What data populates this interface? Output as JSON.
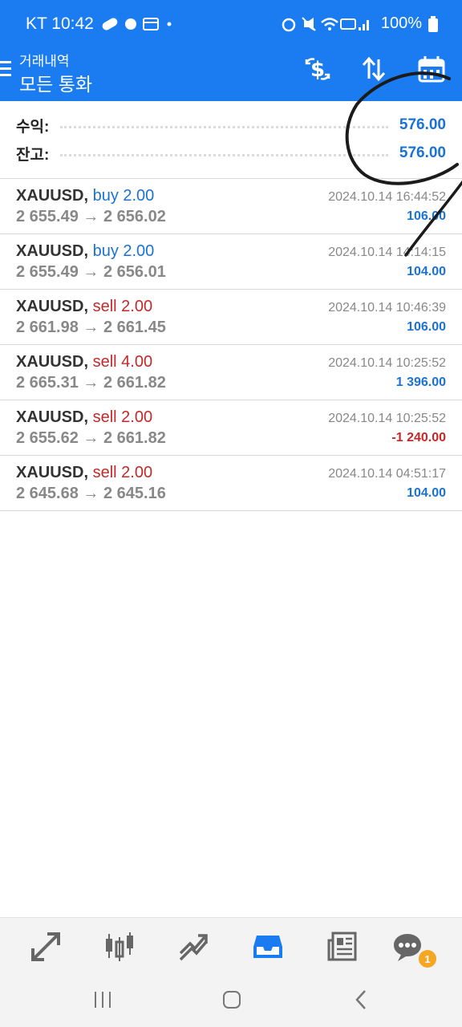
{
  "status_bar": {
    "carrier_time": "KT 10:42",
    "battery": "100%"
  },
  "app_bar": {
    "subtitle": "거래내역",
    "title": "모든 통화",
    "icons": [
      "currency-exchange-icon",
      "sort-icon",
      "calendar-icon"
    ]
  },
  "summary": {
    "profit_label": "수익:",
    "profit_value": "576.00",
    "balance_label": "잔고:",
    "balance_value": "576.00"
  },
  "deals": [
    {
      "symbol": "XAUUSD,",
      "type": "buy 2.00",
      "side": "buy",
      "prices": "2 655.49 → 2 656.02",
      "time": "2024.10.14 16:44:52",
      "profit": "106.00",
      "profit_sign": "pos"
    },
    {
      "symbol": "XAUUSD,",
      "type": "buy 2.00",
      "side": "buy",
      "prices": "2 655.49 → 2 656.01",
      "time": "2024.10.14 14:14:15",
      "profit": "104.00",
      "profit_sign": "pos"
    },
    {
      "symbol": "XAUUSD,",
      "type": "sell 2.00",
      "side": "sell",
      "prices": "2 661.98 → 2 661.45",
      "time": "2024.10.14 10:46:39",
      "profit": "106.00",
      "profit_sign": "pos"
    },
    {
      "symbol": "XAUUSD,",
      "type": "sell 4.00",
      "side": "sell",
      "prices": "2 665.31 → 2 661.82",
      "time": "2024.10.14 10:25:52",
      "profit": "1 396.00",
      "profit_sign": "pos"
    },
    {
      "symbol": "XAUUSD,",
      "type": "sell 2.00",
      "side": "sell",
      "prices": "2 655.62 → 2 661.82",
      "time": "2024.10.14 10:25:52",
      "profit": "-1 240.00",
      "profit_sign": "neg"
    },
    {
      "symbol": "XAUUSD,",
      "type": "sell 2.00",
      "side": "sell",
      "prices": "2 645.68 → 2 645.16",
      "time": "2024.10.14 04:51:17",
      "profit": "104.00",
      "profit_sign": "pos"
    }
  ],
  "bottom_nav": {
    "items": [
      "quotes-icon",
      "chart-icon",
      "trade-icon",
      "history-icon",
      "news-icon",
      "chat-icon"
    ],
    "active": "history-icon",
    "chat_badge": "1"
  },
  "colors": {
    "accent": "#1a7cf0",
    "buy": "#1a73d4",
    "sell": "#c62828"
  }
}
